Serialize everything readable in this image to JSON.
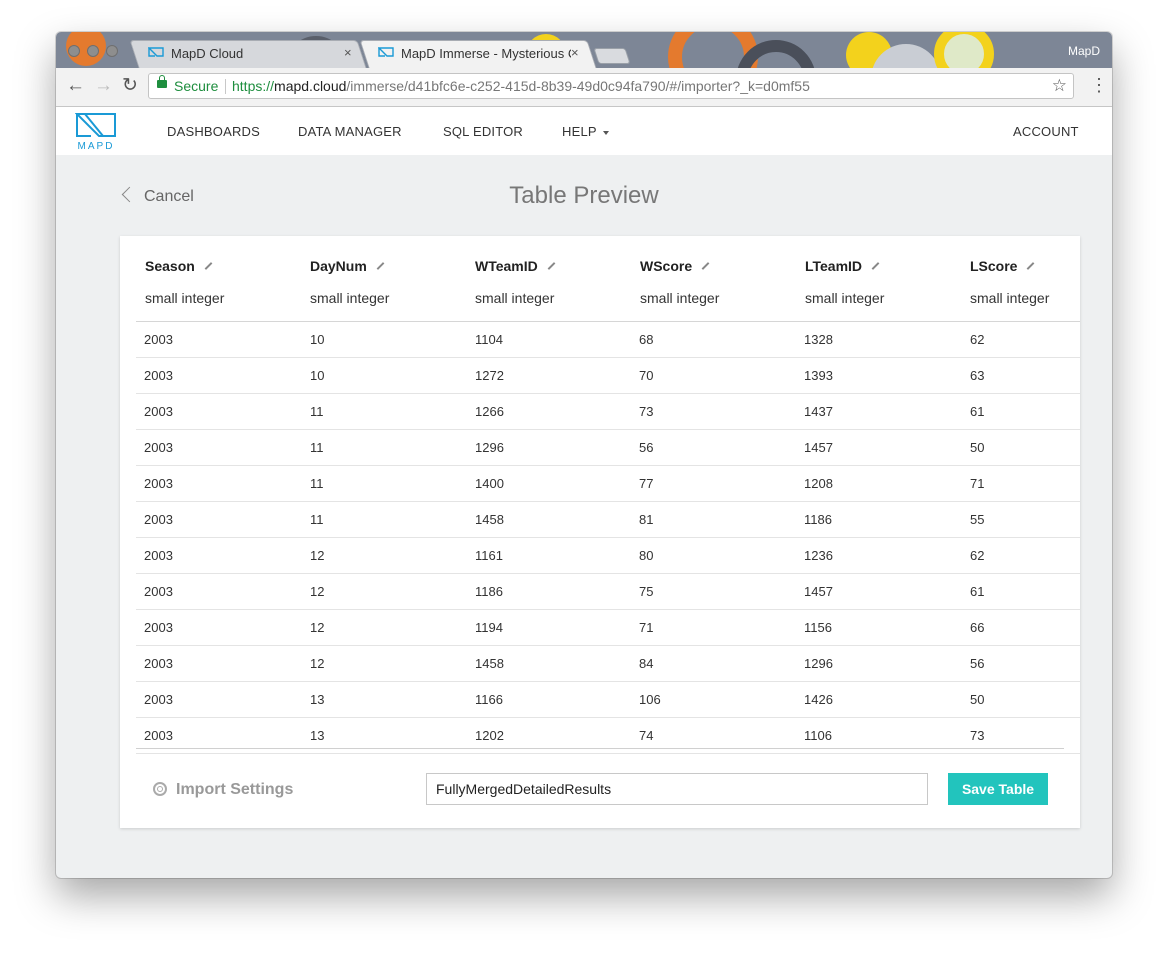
{
  "browser": {
    "tabs": [
      {
        "label": "MapD Cloud",
        "close": "×"
      },
      {
        "label": "MapD Immerse - Mysterious C",
        "close": "×"
      }
    ],
    "profile_name": "MapD",
    "address": {
      "secure_label": "Secure",
      "url_scheme": "https://",
      "url_host": "mapd.cloud",
      "url_path": "/immerse/d41bfc6e-c252-415d-8b39-49d0c94fa790/#/importer?_k=d0mf55"
    },
    "icons": {
      "back": "back-arrow-icon",
      "forward": "forward-arrow-icon",
      "reload": "reload-icon",
      "star": "bookmark-star-icon",
      "menu": "kebab-menu-icon",
      "lock": "lock-icon"
    }
  },
  "nav": {
    "logo_text": "MAPD",
    "items": [
      "DASHBOARDS",
      "DATA MANAGER",
      "SQL EDITOR",
      "HELP"
    ],
    "account": "ACCOUNT"
  },
  "page": {
    "cancel_label": "Cancel",
    "title": "Table Preview"
  },
  "table": {
    "columns": [
      {
        "name": "Season",
        "type": "small integer"
      },
      {
        "name": "DayNum",
        "type": "small integer"
      },
      {
        "name": "WTeamID",
        "type": "small integer"
      },
      {
        "name": "WScore",
        "type": "small integer"
      },
      {
        "name": "LTeamID",
        "type": "small integer"
      },
      {
        "name": "LScore",
        "type": "small integer"
      }
    ],
    "rows": [
      [
        "2003",
        "10",
        "1104",
        "68",
        "1328",
        "62"
      ],
      [
        "2003",
        "10",
        "1272",
        "70",
        "1393",
        "63"
      ],
      [
        "2003",
        "11",
        "1266",
        "73",
        "1437",
        "61"
      ],
      [
        "2003",
        "11",
        "1296",
        "56",
        "1457",
        "50"
      ],
      [
        "2003",
        "11",
        "1400",
        "77",
        "1208",
        "71"
      ],
      [
        "2003",
        "11",
        "1458",
        "81",
        "1186",
        "55"
      ],
      [
        "2003",
        "12",
        "1161",
        "80",
        "1236",
        "62"
      ],
      [
        "2003",
        "12",
        "1186",
        "75",
        "1457",
        "61"
      ],
      [
        "2003",
        "12",
        "1194",
        "71",
        "1156",
        "66"
      ],
      [
        "2003",
        "12",
        "1458",
        "84",
        "1296",
        "56"
      ],
      [
        "2003",
        "13",
        "1166",
        "106",
        "1426",
        "50"
      ],
      [
        "2003",
        "13",
        "1202",
        "74",
        "1106",
        "73"
      ]
    ]
  },
  "footer": {
    "import_settings_label": "Import Settings",
    "table_name_value": "FullyMergedDetailedResults",
    "save_label": "Save Table"
  },
  "colors": {
    "accent": "#22c4bd",
    "brand": "#1a9ad6",
    "secure_green": "#1e8e3e"
  }
}
